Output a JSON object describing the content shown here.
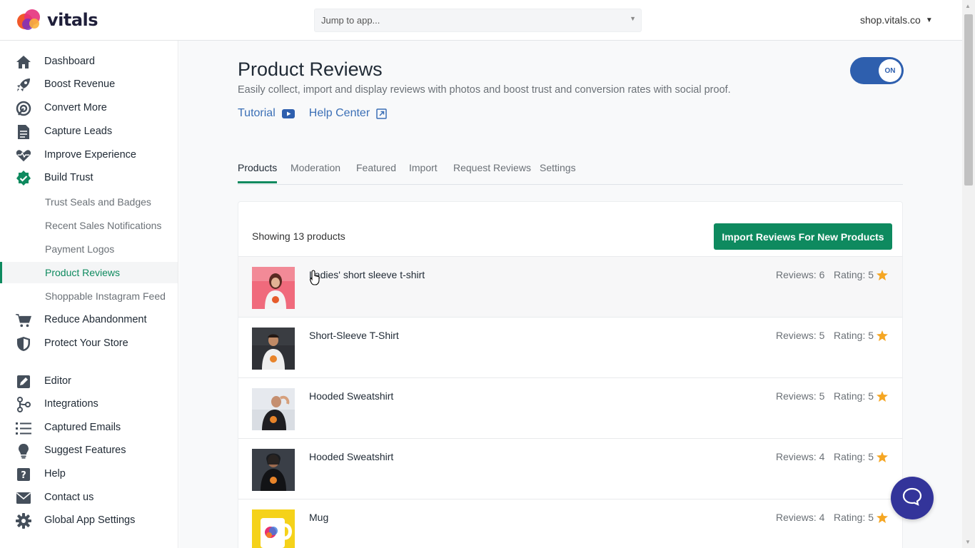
{
  "brand": {
    "name": "vitals"
  },
  "topbar": {
    "jump_placeholder": "Jump to app...",
    "shop": "shop.vitals.co"
  },
  "sidebar": {
    "items": [
      {
        "label": "Dashboard",
        "icon": "home-icon"
      },
      {
        "label": "Boost Revenue",
        "icon": "rocket-icon"
      },
      {
        "label": "Convert More",
        "icon": "target-icon"
      },
      {
        "label": "Capture Leads",
        "icon": "document-icon"
      },
      {
        "label": "Improve Experience",
        "icon": "heartbeat-icon"
      },
      {
        "label": "Build Trust",
        "icon": "check-badge-icon"
      },
      {
        "label": "Reduce Abandonment",
        "icon": "cart-icon"
      },
      {
        "label": "Protect Your Store",
        "icon": "shield-icon"
      },
      {
        "label": "Editor",
        "icon": "edit-icon"
      },
      {
        "label": "Integrations",
        "icon": "integrations-icon"
      },
      {
        "label": "Captured Emails",
        "icon": "list-icon"
      },
      {
        "label": "Suggest Features",
        "icon": "lightbulb-icon"
      },
      {
        "label": "Help",
        "icon": "question-icon"
      },
      {
        "label": "Contact us",
        "icon": "envelope-icon"
      },
      {
        "label": "Global App Settings",
        "icon": "gear-icon"
      }
    ],
    "sub_items": [
      {
        "label": "Trust Seals and Badges"
      },
      {
        "label": "Recent Sales Notifications"
      },
      {
        "label": "Payment Logos"
      },
      {
        "label": "Product Reviews",
        "active": true
      },
      {
        "label": "Shoppable Instagram Feed"
      }
    ]
  },
  "page": {
    "title": "Product Reviews",
    "subtitle": "Easily collect, import and display reviews with photos and boost trust and conversion rates with social proof.",
    "tutorial_label": "Tutorial",
    "help_center_label": "Help Center",
    "toggle_label": "ON",
    "tabs": [
      {
        "label": "Products",
        "active": true
      },
      {
        "label": "Moderation"
      },
      {
        "label": "Featured"
      },
      {
        "label": "Import"
      },
      {
        "label": "Request Reviews"
      },
      {
        "label": "Settings"
      }
    ],
    "showing": "Showing 13 products",
    "import_button": "Import Reviews For New Products",
    "products": [
      {
        "name": "Ladies' short sleeve t-shirt",
        "reviews": "Reviews: 6",
        "rating": "Rating: 5"
      },
      {
        "name": "Short-Sleeve T-Shirt",
        "reviews": "Reviews: 5",
        "rating": "Rating: 5"
      },
      {
        "name": "Hooded Sweatshirt",
        "reviews": "Reviews: 5",
        "rating": "Rating: 5"
      },
      {
        "name": "Hooded Sweatshirt",
        "reviews": "Reviews: 4",
        "rating": "Rating: 5"
      },
      {
        "name": "Mug",
        "reviews": "Reviews: 4",
        "rating": "Rating: 5"
      }
    ]
  },
  "colors": {
    "accent": "#0e8a5f",
    "link": "#3b6fb6",
    "toggle": "#2e5fae",
    "star": "#f5a623",
    "chat": "#33349a"
  }
}
